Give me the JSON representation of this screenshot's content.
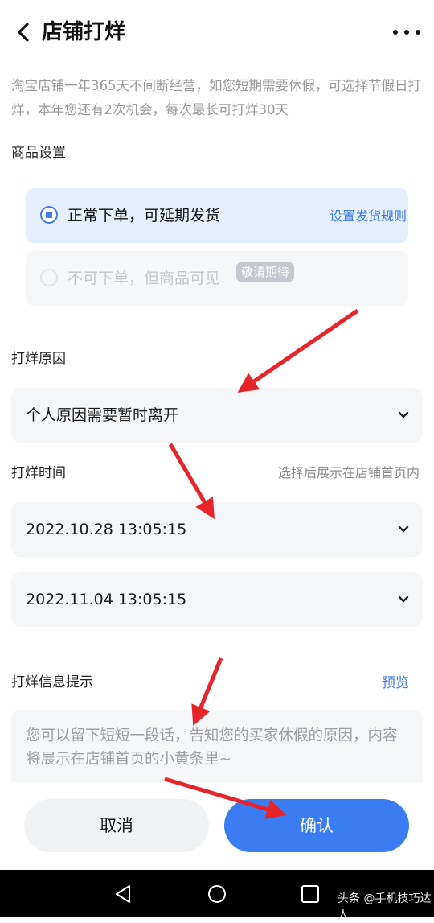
{
  "header": {
    "title": "店铺打烊",
    "back_icon": "chevron-left-icon",
    "more_icon": "more-dots-icon"
  },
  "description": "淘宝店铺一年365天不间断经营，如您短期需要休假，可选择节假日打烊，本年您还有2次机会，每次最长可打烊30天",
  "goods_settings": {
    "label": "商品设置",
    "options": [
      {
        "text": "正常下单，可延期发货",
        "selected": true,
        "link": "设置发货规则"
      },
      {
        "text": "不可下单，但商品可见",
        "selected": false,
        "disabled": true,
        "badge": "敬请期待"
      }
    ]
  },
  "reason": {
    "label": "打烊原因",
    "value": "个人原因需要暂时离开"
  },
  "time": {
    "label": "打烊时间",
    "hint": "选择后展示在店铺首页内",
    "start": "2022.10.28 13:05:15",
    "end": "2022.11.04 13:05:15"
  },
  "notice": {
    "label": "打烊信息提示",
    "preview_link": "预览",
    "placeholder": "您可以留下短短一段话，告知您的买家休假的原因，内容将展示在店铺首页的小黄条里~"
  },
  "buttons": {
    "cancel": "取消",
    "confirm": "确认"
  },
  "watermark": "头条 @手机技巧达人",
  "colors": {
    "accent": "#3a7df2",
    "selected_bg": "#e6effd",
    "arrow": "#e8242b"
  }
}
